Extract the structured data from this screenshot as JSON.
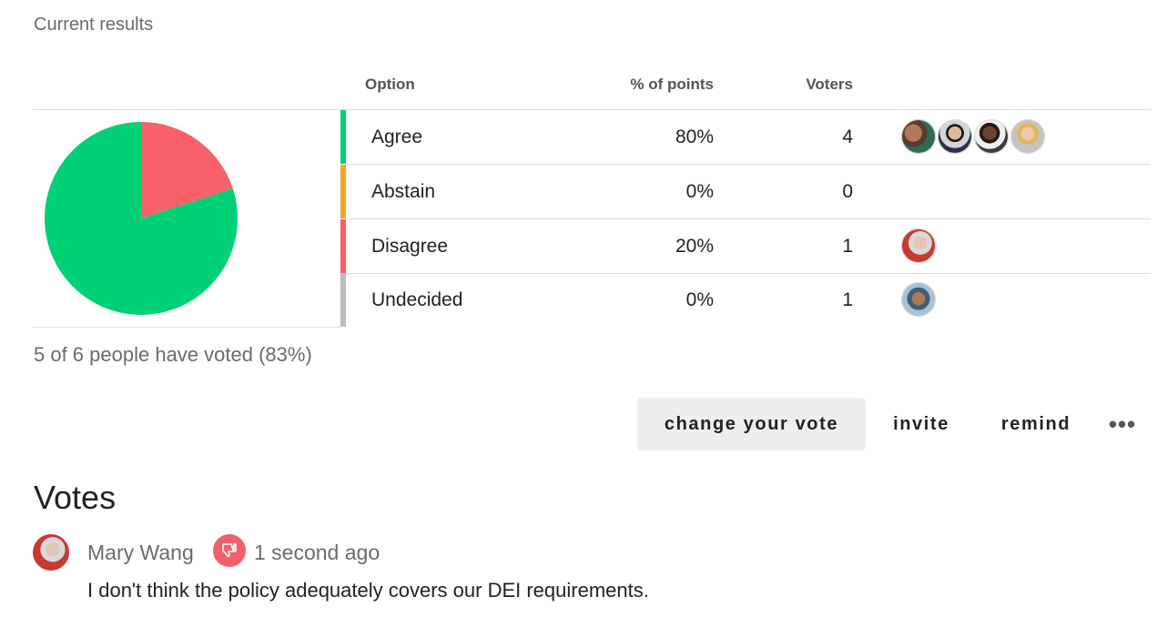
{
  "results": {
    "title": "Current results",
    "columns": {
      "option": "Option",
      "points": "% of points",
      "voters": "Voters"
    },
    "options": [
      {
        "label": "Agree",
        "percent": "80%",
        "voters": "4",
        "color": "#00d076"
      },
      {
        "label": "Abstain",
        "percent": "0%",
        "voters": "0",
        "color": "#f5a623"
      },
      {
        "label": "Disagree",
        "percent": "20%",
        "voters": "1",
        "color": "#f8606a"
      },
      {
        "label": "Undecided",
        "percent": "0%",
        "voters": "1",
        "color": "#bdbdbd"
      }
    ],
    "summary": "5 of 6 people have voted (83%)",
    "pie": [
      {
        "label": "Agree",
        "value": 80,
        "color": "#00d076"
      },
      {
        "label": "Disagree",
        "value": 20,
        "color": "#f8606a"
      }
    ]
  },
  "actions": {
    "change_vote": "change your vote",
    "invite": "invite",
    "remind": "remind",
    "more": "•••"
  },
  "votes": {
    "heading": "Votes",
    "entries": [
      {
        "name": "Mary Wang",
        "icon": "thumbs-down-icon",
        "time": "1 second ago",
        "text": "I don't think the policy adequately covers our DEI requirements."
      }
    ]
  }
}
